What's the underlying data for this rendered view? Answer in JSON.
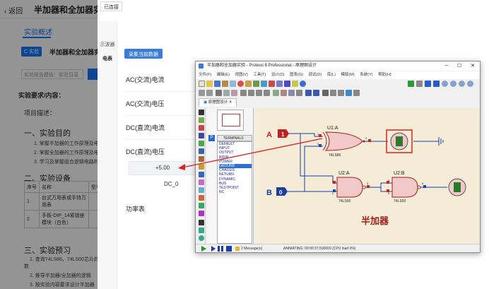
{
  "background_page": {
    "back_label": "返回",
    "title": "半加器和全加器实验",
    "overview_tab": "实验概述",
    "exp_badge": "C 实验",
    "exp_name": "半加器和全加器实验",
    "report_placeholder": "实验报告模板：实验目录",
    "requirements_label": "实验要求/内容：",
    "project_desc": "项目描述：",
    "section1": "一、实验目的",
    "purpose": [
      "1. 掌握半加器的工作原理及电",
      "2. 掌握全加器的工作原理及电",
      "3. 学习及掌握组合逻辑电路的"
    ],
    "section2": "二、实验设备",
    "table_header": [
      "序号",
      "名称",
      "型号"
    ],
    "table_rows": [
      [
        "1",
        "台式万用表或手持万用表",
        ""
      ],
      [
        "2",
        "手板-DIP_14紧锁座模块（白色）",
        ""
      ]
    ],
    "section3": "三、实验预习",
    "prep": [
      "1. 查询74LS86、74LS00芯片的",
      "数",
      "2. 推导半加器/全加器的逻辑",
      "3. 按实验内容要求设计半加器"
    ]
  },
  "panel": {
    "connected_label": "已连接",
    "side_tabs": [
      "示波器",
      "电表"
    ],
    "collect_button": "采集当前数据",
    "meter_rows": [
      "AC(交流)电流",
      "AC(交流)电压",
      "DC(直流)电流",
      "DC(直流)电压"
    ],
    "dc_voltage_value": "+5.00",
    "dc_zero_label": "DC_0",
    "power_label": "功率表"
  },
  "proteus": {
    "title": "半加器和全加器实验 - Proteus 8 Professional - 原理图设计",
    "menu": [
      "文件(F)",
      "编辑(E)",
      "视图(V)",
      "工具(T)",
      "设计(D)",
      "图表(G)",
      "调试(D)",
      "库(L)",
      "模版(M)",
      "系统(Y)",
      "帮助(H)"
    ],
    "doc_tab": "原理图设计",
    "terminals_header": "TERMINALS",
    "terminals": [
      "DEFAULT",
      "INPUT",
      "OUTPUT",
      "BIDIR",
      "POWER",
      "GROUND",
      "CHASSIS",
      "RETURN",
      "DYNAMIC",
      "BUS",
      "TESTPOINT",
      "NC"
    ],
    "selected_terminal": "GROUND",
    "schematic": {
      "input_a_label": "A",
      "input_a_value": "1",
      "input_b_label": "B",
      "input_b_value": "0",
      "gate1_ref": "U1:A",
      "gate1_part": "74LS86",
      "gate2_ref": "U2:A",
      "gate2_part": "74LS00",
      "gate3_ref": "U2:B",
      "gate3_part": "74LS00",
      "pin_u1_1": "1",
      "pin_u1_2": "2",
      "pin_u1_3": "3",
      "pin_u2_1": "1",
      "pin_u2_2": "2",
      "pin_u2_3": "3",
      "pin_u2_4": "4",
      "pin_u2_5": "5",
      "pin_u2_6": "6",
      "caption": "半加器"
    },
    "status_messages": "2 Message(s)",
    "status_animating": "ANIMATING: 00:00:37.500000 (CPU load 0%)"
  },
  "colors": {
    "accent": "#1677ff",
    "collect_button": "#3a7dd8",
    "wire": "#1a3fa6",
    "gate_fill": "#f2c9c9",
    "gate_stroke": "#a02020",
    "schematic_bg": "#f4ecd6",
    "arrow": "#e02020"
  }
}
